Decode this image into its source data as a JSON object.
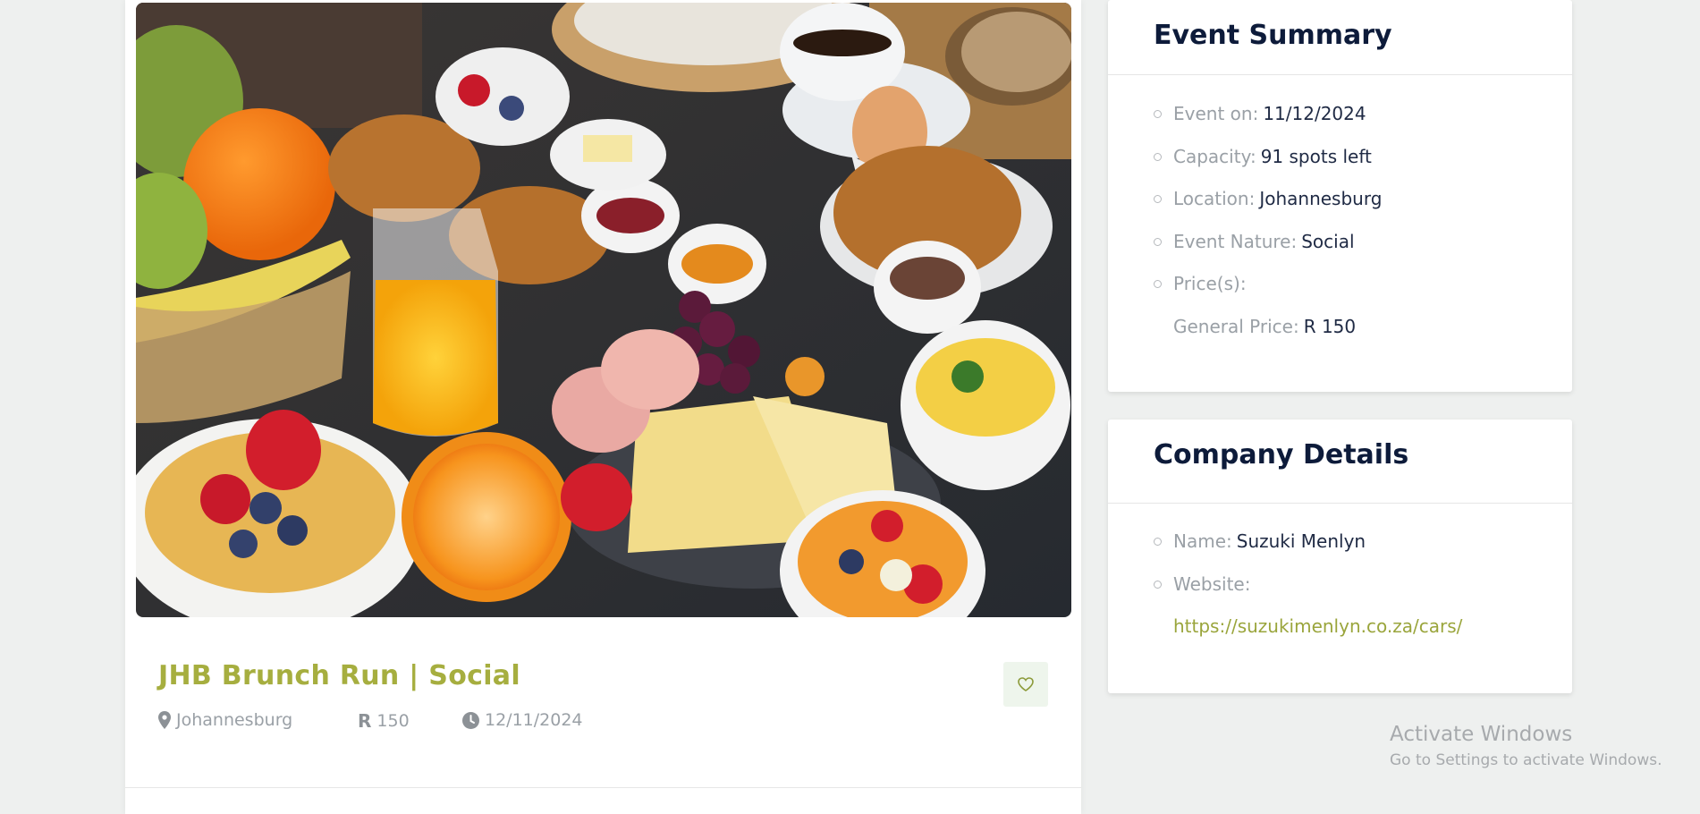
{
  "event": {
    "title": "JHB Brunch Run | Social",
    "location": "Johannesburg",
    "price": "150",
    "date": "12/11/2024",
    "price_symbol": "R"
  },
  "event_summary": {
    "heading": "Event Summary",
    "items": [
      {
        "label": "Event on:",
        "value": "11/12/2024"
      },
      {
        "label": "Capacity:",
        "value": "91 spots left"
      },
      {
        "label": "Location:",
        "value": "Johannesburg"
      },
      {
        "label": "Event Nature:",
        "value": "Social"
      },
      {
        "label": "Price(s):",
        "value": ""
      }
    ],
    "sub_price": {
      "label": "General Price:",
      "value": "R 150"
    }
  },
  "company_details": {
    "heading": "Company Details",
    "items": [
      {
        "label": "Name:",
        "value": "Suzuki Menlyn"
      },
      {
        "label": "Website:",
        "value": ""
      }
    ],
    "website_link": "https://suzukimenlyn.co.za/cars/"
  },
  "windows_watermark": {
    "line1": "Activate Windows",
    "line2": "Go to Settings to activate Windows."
  },
  "icons": {
    "location": "map-pin-icon",
    "price": "rand-symbol",
    "date": "clock-icon",
    "favorite": "heart-icon"
  },
  "colors": {
    "accent": "#a6ae3f",
    "heading": "#0d1b3a",
    "muted": "#9aa0a6",
    "background": "#eef0ef"
  }
}
